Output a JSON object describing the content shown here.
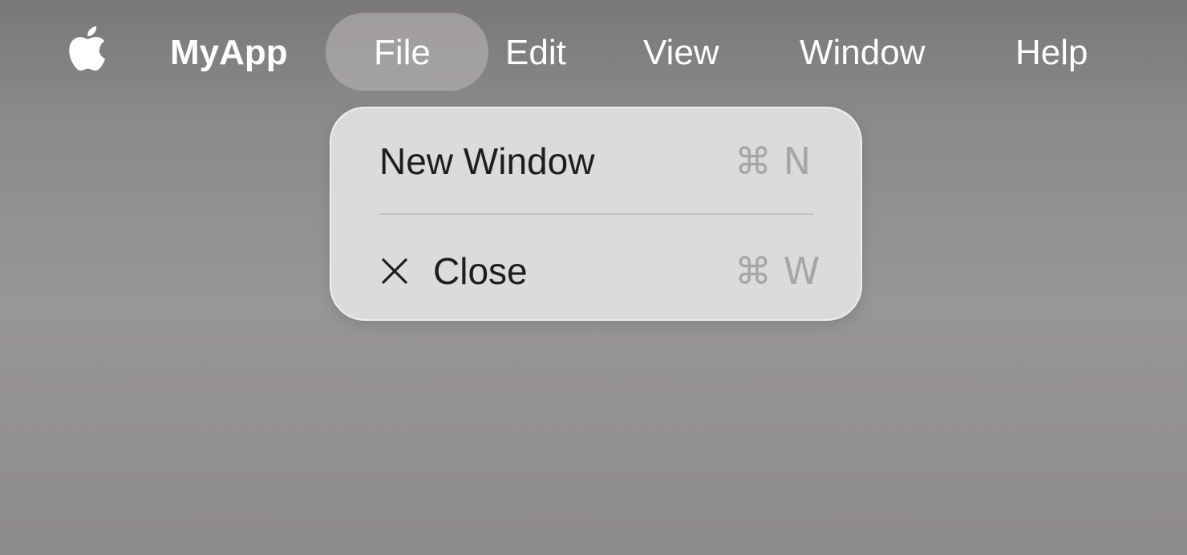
{
  "menubar": {
    "apple_icon": "apple-logo-icon",
    "app_name": "MyApp",
    "menus": [
      "File",
      "Edit",
      "View",
      "Window",
      "Help"
    ],
    "active_menu": "File"
  },
  "file_menu": {
    "items": [
      {
        "label": "New Window",
        "shortcut": "⌘ N",
        "icon": null
      },
      {
        "label": "Close",
        "shortcut": "⌘ W",
        "icon": "close-x-icon"
      }
    ]
  },
  "colors": {
    "menubar_text": "#ffffff",
    "menu_background": "#dcdadb",
    "menu_text": "#1d1d1f",
    "shortcut_text": "#a7a5a6",
    "highlight": "#bebabb"
  }
}
